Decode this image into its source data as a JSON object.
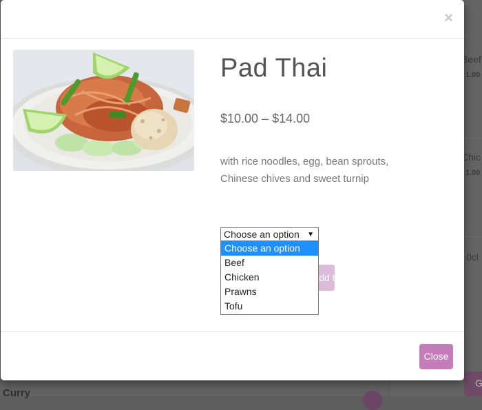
{
  "product": {
    "title": "Pad Thai",
    "price": "$10.00 – $14.00",
    "description": "with rice noodles, egg, bean sprouts, Chinese chives and sweet turnip",
    "add_to_cart_label": "Add to cart",
    "image_alt": "pad-thai-dish"
  },
  "variation": {
    "selected": "Choose an option",
    "options": [
      "Choose an option",
      "Beef",
      "Chicken",
      "Prawns",
      "Tofu"
    ]
  },
  "modal": {
    "close_x": "×",
    "close_label": "Close"
  },
  "background": {
    "items": [
      {
        "text": "Beef",
        "price": "1.00"
      },
      {
        "text": "Chic",
        "price": "1.00"
      },
      {
        "text": "0cl"
      }
    ],
    "curry_label": "Curry",
    "button_label": "G"
  },
  "colors": {
    "accent": "#c57cb9",
    "accent_disabled": "#dcbcda",
    "selected_option": "#1e90ff"
  }
}
